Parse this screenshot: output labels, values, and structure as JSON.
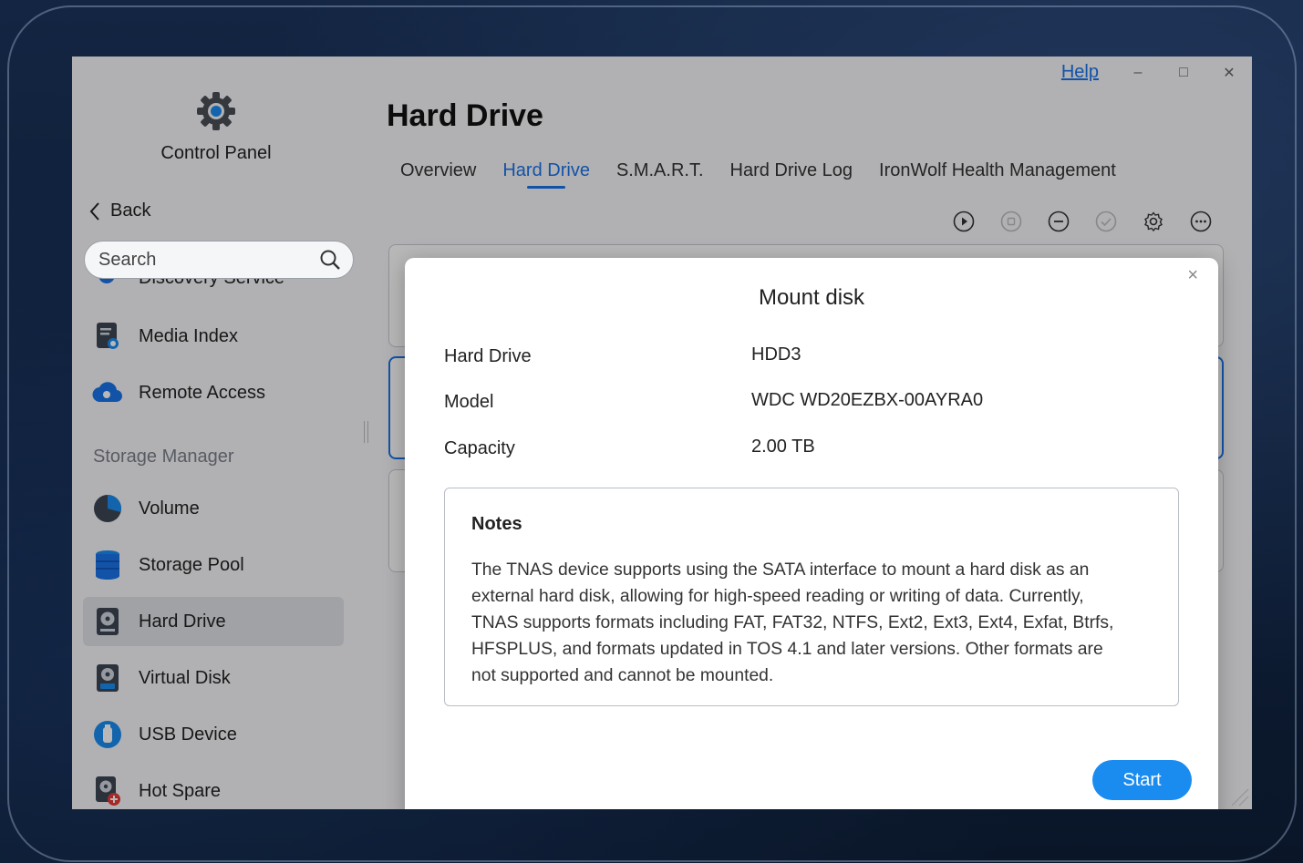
{
  "window": {
    "help_label": "Help",
    "minimize": "–",
    "maximize": "□",
    "close": "✕"
  },
  "sidebar": {
    "title": "Control Panel",
    "back_label": "Back",
    "search_placeholder": "Search",
    "clipped_item": "Discovery Service",
    "items_top": [
      {
        "label": "Media Index",
        "icon": "media-index-icon"
      },
      {
        "label": "Remote Access",
        "icon": "cloud-icon"
      }
    ],
    "section_label": "Storage Manager",
    "items": [
      {
        "label": "Volume",
        "icon": "pie-icon"
      },
      {
        "label": "Storage Pool",
        "icon": "database-icon"
      },
      {
        "label": "Hard Drive",
        "icon": "hard-drive-icon",
        "active": true
      },
      {
        "label": "Virtual Disk",
        "icon": "virtual-disk-icon"
      },
      {
        "label": "USB Device",
        "icon": "usb-icon"
      },
      {
        "label": "Hot Spare",
        "icon": "hot-spare-icon"
      }
    ]
  },
  "main": {
    "title": "Hard Drive",
    "tabs": [
      "Overview",
      "Hard Drive",
      "S.M.A.R.T.",
      "Hard Drive Log",
      "IronWolf Health Management"
    ],
    "active_tab": "Hard Drive",
    "toolbar": [
      "play-icon",
      "stop-icon",
      "remove-icon",
      "check-icon",
      "settings-icon",
      "more-icon"
    ]
  },
  "dialog": {
    "title": "Mount disk",
    "close": "×",
    "fields": [
      {
        "label": "Hard Drive",
        "value": "HDD3"
      },
      {
        "label": "Model",
        "value": "WDC WD20EZBX-00AYRA0"
      },
      {
        "label": "Capacity",
        "value": "2.00 TB"
      }
    ],
    "notes_title": "Notes",
    "notes_lines": [
      "The TNAS device supports using the SATA interface to mount a hard disk as an",
      "external hard disk, allowing for high-speed reading or writing of data. Currently,",
      "TNAS supports formats including FAT, FAT32, NTFS, Ext2, Ext3, Ext4, Exfat, Btrfs,",
      "HFSPLUS, and formats updated in TOS 4.1 and later versions. Other formats are",
      "not supported and cannot be mounted."
    ],
    "start_label": "Start"
  },
  "colors": {
    "accent": "#1a73e8",
    "button": "#1a8cf0"
  }
}
